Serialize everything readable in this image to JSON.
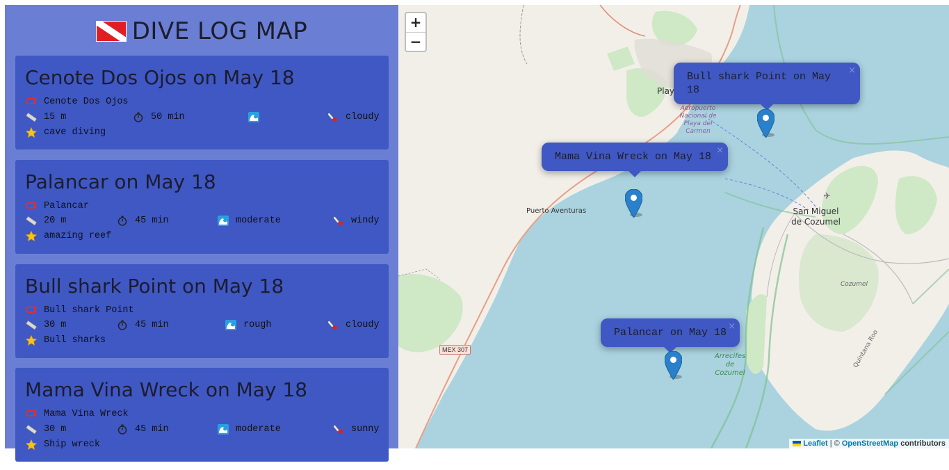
{
  "app": {
    "title": "DIVE LOG MAP",
    "flag_icon": "dive-flag-icon"
  },
  "dives": [
    {
      "title": "Cenote Dos Ojos on May 18",
      "site": "Cenote Dos Ojos",
      "depth": "15 m",
      "duration": "50 min",
      "conditions": "",
      "weather": "cloudy",
      "highlight": "cave diving"
    },
    {
      "title": "Palancar on May 18",
      "site": "Palancar",
      "depth": "20 m",
      "duration": "45 min",
      "conditions": "moderate",
      "weather": "windy",
      "highlight": "amazing reef"
    },
    {
      "title": "Bull shark Point on May 18",
      "site": "Bull shark Point",
      "depth": "30 m",
      "duration": "45 min",
      "conditions": "rough",
      "weather": "cloudy",
      "highlight": "Bull sharks"
    },
    {
      "title": "Mama Vina Wreck on May 18",
      "site": "Mama Vina Wreck",
      "depth": "30 m",
      "duration": "45 min",
      "conditions": "moderate",
      "weather": "sunny",
      "highlight": "Ship wreck"
    }
  ],
  "map": {
    "zoom_in": "+",
    "zoom_out": "−",
    "popup_close": "×",
    "popups": {
      "bull_shark": "Bull shark Point on May 18",
      "mama_vina": "Mama Vina Wreck on May 18",
      "palancar": "Palancar on May 18"
    },
    "labels": {
      "playa": "Playa",
      "airport": "Aeropuerto Nacional de Playa del Carmen",
      "puerto_aventuras": "Puerto Aventuras",
      "san_miguel": "San Miguel de Cozumel",
      "cozumel": "Cozumel",
      "arrecifes": "Arrecifes de Cozumel",
      "road": "MEX 307",
      "quintana_roo": "Quintana Roo"
    },
    "attribution": {
      "leaflet": "Leaflet",
      "separator": "| ©",
      "osm": "OpenStreetMap",
      "contributors": "contributors"
    }
  },
  "colors": {
    "sidebar_bg": "#6a7fd3",
    "card_bg": "#3f58c4",
    "water": "#aad3df",
    "land": "#f2efe9",
    "marker": "#2a81cb"
  }
}
